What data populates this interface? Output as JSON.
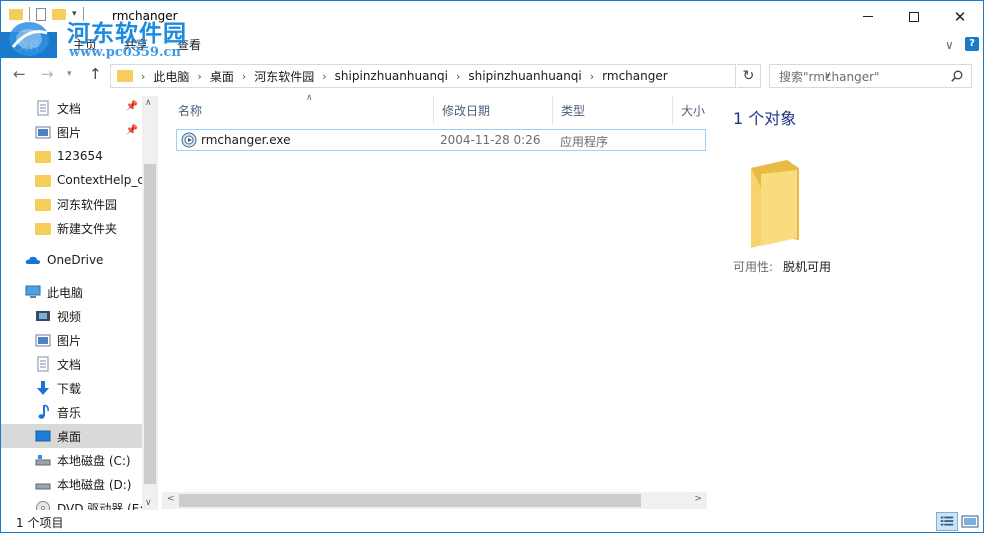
{
  "window": {
    "title": "rmchanger",
    "minimize": "—",
    "maximize": "□",
    "close": "✕"
  },
  "watermark": {
    "text": "河东软件园",
    "url": "www.pc0359.cn"
  },
  "ribbon": {
    "file_tab": "文件",
    "tabs": [
      "主页",
      "共享",
      "查看"
    ],
    "collapse": "∨",
    "help": "?"
  },
  "address": {
    "crumbs": [
      "此电脑",
      "桌面",
      "河东软件园",
      "shipinzhuanhuanqi",
      "shipinzhuanhuanqi",
      "rmchanger"
    ],
    "search_placeholder": "搜索\"rmchanger\""
  },
  "nav": {
    "quick_access": [
      {
        "label": "文档",
        "icon": "document-icon",
        "pinned": true
      },
      {
        "label": "图片",
        "icon": "pictures-icon",
        "pinned": true
      },
      {
        "label": "123654",
        "icon": "folder-icon"
      },
      {
        "label": "ContextHelp_cr",
        "icon": "folder-icon"
      },
      {
        "label": "河东软件园",
        "icon": "folder-icon"
      },
      {
        "label": "新建文件夹",
        "icon": "folder-icon"
      }
    ],
    "onedrive": "OneDrive",
    "this_pc": "此电脑",
    "pc_items": [
      {
        "label": "视频",
        "icon": "videos-icon"
      },
      {
        "label": "图片",
        "icon": "pictures-icon"
      },
      {
        "label": "文档",
        "icon": "document-icon"
      },
      {
        "label": "下载",
        "icon": "download-icon"
      },
      {
        "label": "音乐",
        "icon": "music-icon"
      },
      {
        "label": "桌面",
        "icon": "desktop-icon",
        "selected": true
      },
      {
        "label": "本地磁盘 (C:)",
        "icon": "drive-icon"
      },
      {
        "label": "本地磁盘 (D:)",
        "icon": "drive-icon"
      },
      {
        "label": "DVD 驱动器 (E:)",
        "icon": "dvd-icon"
      }
    ]
  },
  "columns": {
    "name": "名称",
    "date": "修改日期",
    "type": "类型",
    "size": "大小"
  },
  "files": [
    {
      "name": "rmchanger.exe",
      "date": "2004-11-28 0:26",
      "type": "应用程序"
    }
  ],
  "details": {
    "count": "1 个对象",
    "availability_label": "可用性:",
    "availability_value": "脱机可用"
  },
  "status": {
    "text": "1 个项目"
  },
  "colors": {
    "accent": "#1979ca",
    "folder": "#f5cd5a",
    "selection_border": "#99d1ff",
    "details_title": "#1e3287"
  }
}
